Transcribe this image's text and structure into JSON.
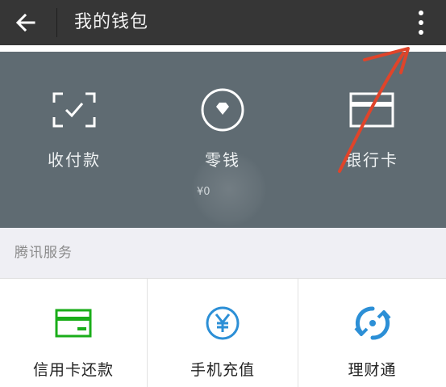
{
  "appbar": {
    "title": "我的钱包",
    "back_icon": "arrow-left-icon",
    "more_icon": "more-vertical-icon"
  },
  "wallet_panel": {
    "items": [
      {
        "label": "收付款",
        "icon": "scan-check-icon"
      },
      {
        "label": "零钱",
        "icon": "diamond-circle-icon"
      },
      {
        "label": "银行卡",
        "icon": "bank-card-icon"
      }
    ],
    "sub_text": "¥0"
  },
  "section": {
    "title": "腾讯服务"
  },
  "services": [
    {
      "label": "信用卡还款",
      "icon": "credit-card-icon",
      "color": "#1aad19"
    },
    {
      "label": "手机充值",
      "icon": "yuan-circle-icon",
      "color": "#2c8fd6"
    },
    {
      "label": "理财通",
      "icon": "licaitong-icon",
      "color": "#2c8fd6"
    }
  ],
  "colors": {
    "appbar_bg": "#363636",
    "panel_bg": "#5f6b72",
    "annotation_arrow": "#e0442a"
  }
}
